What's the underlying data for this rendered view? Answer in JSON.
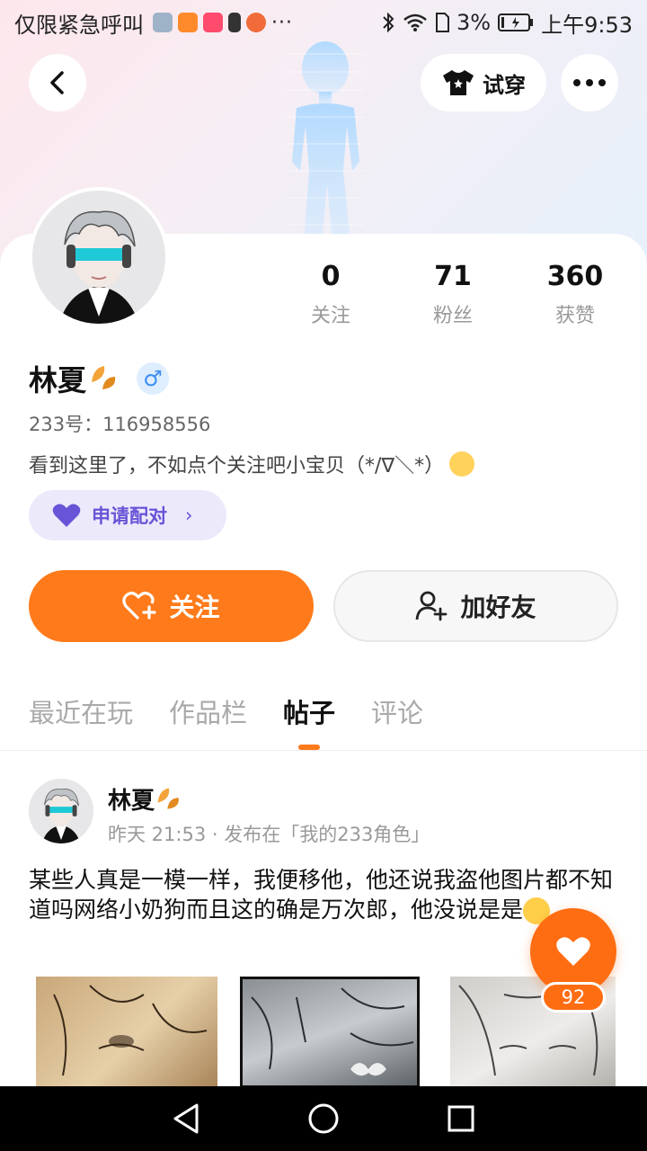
{
  "status_bar": {
    "carrier": "仅限紧急呼叫",
    "battery_percent": "3%",
    "time": "上午9:53",
    "more": "···"
  },
  "header": {
    "try_on_label": "试穿"
  },
  "profile": {
    "stats": [
      {
        "value": "0",
        "label": "关注"
      },
      {
        "value": "71",
        "label": "粉丝"
      },
      {
        "value": "360",
        "label": "获赞"
      }
    ],
    "name": "林夏",
    "gender_symbol": "♂",
    "uid": "233号：116958556",
    "bio": "看到这里了，不如点个关注吧小宝贝（*/∇＼*）",
    "match_label": "申请配对",
    "match_chevron": "›"
  },
  "actions": {
    "follow_label": "关注",
    "add_friend_label": "加好友"
  },
  "tabs": [
    {
      "label": "最近在玩",
      "active": false
    },
    {
      "label": "作品栏",
      "active": false
    },
    {
      "label": "帖子",
      "active": true
    },
    {
      "label": "评论",
      "active": false
    }
  ],
  "post": {
    "author": "林夏",
    "meta": "昨天 21:53 · 发布在「我的233角色」",
    "text": "某些人真是一模一样，我便移他，他还说我盗他图片都不知道吗网络小奶狗而且这的确是万次郎，他没说是是"
  },
  "like": {
    "count": "92"
  },
  "colors": {
    "accent": "#ff7a1a",
    "match_purple": "#6754d6",
    "gender_blue": "#3d8ff0"
  }
}
